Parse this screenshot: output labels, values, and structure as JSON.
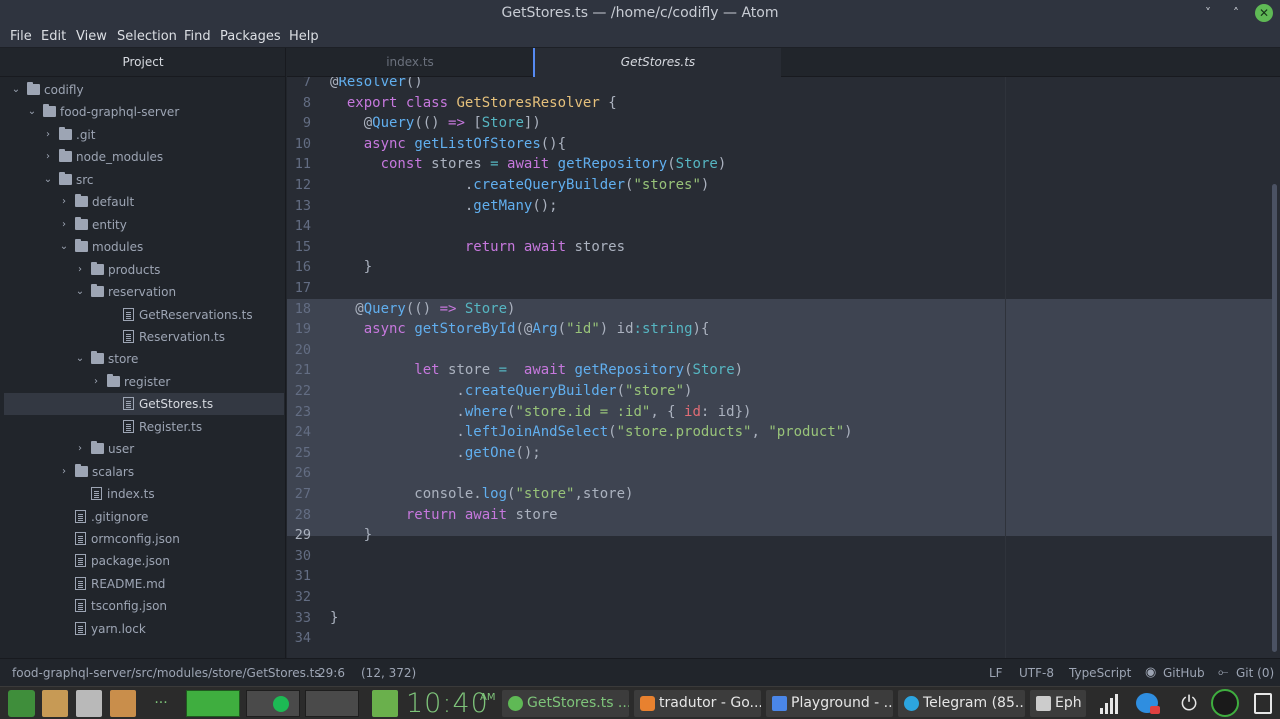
{
  "window": {
    "title": "GetStores.ts — /home/c/codifly — Atom",
    "controls": [
      "˅",
      "˄",
      "✕"
    ]
  },
  "menu": [
    "File",
    "Edit",
    "View",
    "Selection",
    "Find",
    "Packages",
    "Help"
  ],
  "tree": {
    "header": "Project",
    "items": [
      {
        "label": "codifly",
        "type": "folder",
        "depth": 0,
        "expanded": true
      },
      {
        "label": "food-graphql-server",
        "type": "folder",
        "depth": 1,
        "expanded": true
      },
      {
        "label": ".git",
        "type": "folder",
        "depth": 2,
        "expanded": false
      },
      {
        "label": "node_modules",
        "type": "folder",
        "depth": 2,
        "expanded": false
      },
      {
        "label": "src",
        "type": "folder",
        "depth": 2,
        "expanded": true
      },
      {
        "label": "default",
        "type": "folder",
        "depth": 3,
        "expanded": false
      },
      {
        "label": "entity",
        "type": "folder",
        "depth": 3,
        "expanded": false
      },
      {
        "label": "modules",
        "type": "folder",
        "depth": 3,
        "expanded": true
      },
      {
        "label": "products",
        "type": "folder",
        "depth": 4,
        "expanded": false
      },
      {
        "label": "reservation",
        "type": "folder",
        "depth": 4,
        "expanded": true
      },
      {
        "label": "GetReservations.ts",
        "type": "file",
        "depth": 5
      },
      {
        "label": "Reservation.ts",
        "type": "file",
        "depth": 5
      },
      {
        "label": "store",
        "type": "folder",
        "depth": 4,
        "expanded": true
      },
      {
        "label": "register",
        "type": "folder",
        "depth": 5,
        "expanded": false
      },
      {
        "label": "GetStores.ts",
        "type": "file",
        "depth": 5,
        "selected": true
      },
      {
        "label": "Register.ts",
        "type": "file",
        "depth": 5
      },
      {
        "label": "user",
        "type": "folder",
        "depth": 4,
        "expanded": false
      },
      {
        "label": "scalars",
        "type": "folder",
        "depth": 3,
        "expanded": false
      },
      {
        "label": "index.ts",
        "type": "file",
        "depth": 3
      },
      {
        "label": ".gitignore",
        "type": "file",
        "depth": 2
      },
      {
        "label": "ormconfig.json",
        "type": "file",
        "depth": 2
      },
      {
        "label": "package.json",
        "type": "file",
        "depth": 2
      },
      {
        "label": "README.md",
        "type": "file",
        "depth": 2
      },
      {
        "label": "tsconfig.json",
        "type": "file",
        "depth": 2
      },
      {
        "label": "yarn.lock",
        "type": "file",
        "depth": 2
      }
    ]
  },
  "tabs": [
    {
      "label": "index.ts",
      "active": false
    },
    {
      "label": "GetStores.ts",
      "active": true
    }
  ],
  "editor": {
    "first_line_number": 7,
    "cursor_line": 29,
    "selection_lines": [
      18,
      29
    ],
    "lines": [
      [
        [
          "@",
          "d"
        ],
        [
          "Resolver",
          "f"
        ],
        [
          "()",
          "d"
        ]
      ],
      [
        [
          "  ",
          "d"
        ],
        [
          "export",
          "k"
        ],
        [
          " ",
          "d"
        ],
        [
          "class",
          "k"
        ],
        [
          " ",
          "d"
        ],
        [
          "GetStoresResolver",
          "t"
        ],
        [
          " {",
          "d"
        ]
      ],
      [
        [
          "    @",
          "d"
        ],
        [
          "Query",
          "f"
        ],
        [
          "(() ",
          "d"
        ],
        [
          "=>",
          "k"
        ],
        [
          " [",
          "d"
        ],
        [
          "Store",
          "c"
        ],
        [
          "])",
          "d"
        ]
      ],
      [
        [
          "    ",
          "d"
        ],
        [
          "async",
          "k"
        ],
        [
          " ",
          "d"
        ],
        [
          "getListOfStores",
          "f"
        ],
        [
          "(){",
          "d"
        ]
      ],
      [
        [
          "      ",
          "d"
        ],
        [
          "const",
          "k"
        ],
        [
          " stores ",
          "d"
        ],
        [
          "=",
          "c"
        ],
        [
          " ",
          "d"
        ],
        [
          "await",
          "k"
        ],
        [
          " ",
          "d"
        ],
        [
          "getRepository",
          "f"
        ],
        [
          "(",
          "d"
        ],
        [
          "Store",
          "c"
        ],
        [
          ")",
          "d"
        ]
      ],
      [
        [
          "                .",
          "d"
        ],
        [
          "createQueryBuilder",
          "f"
        ],
        [
          "(",
          "d"
        ],
        [
          "\"stores\"",
          "s"
        ],
        [
          ")",
          "d"
        ]
      ],
      [
        [
          "                .",
          "d"
        ],
        [
          "getMany",
          "f"
        ],
        [
          "();",
          "d"
        ]
      ],
      [
        [
          "",
          "d"
        ]
      ],
      [
        [
          "                ",
          "d"
        ],
        [
          "return",
          "k"
        ],
        [
          " ",
          "d"
        ],
        [
          "await",
          "k"
        ],
        [
          " stores",
          "d"
        ]
      ],
      [
        [
          "    }",
          "d"
        ]
      ],
      [
        [
          "",
          "d"
        ]
      ],
      [
        [
          "   @",
          "d"
        ],
        [
          "Query",
          "f"
        ],
        [
          "(() ",
          "d"
        ],
        [
          "=>",
          "k"
        ],
        [
          " ",
          "d"
        ],
        [
          "Store",
          "c"
        ],
        [
          ")",
          "d"
        ]
      ],
      [
        [
          "    ",
          "d"
        ],
        [
          "async",
          "k"
        ],
        [
          " ",
          "d"
        ],
        [
          "getStoreById",
          "f"
        ],
        [
          "(@",
          "d"
        ],
        [
          "Arg",
          "f"
        ],
        [
          "(",
          "d"
        ],
        [
          "\"id\"",
          "s"
        ],
        [
          ") id",
          "d"
        ],
        [
          ":",
          "c"
        ],
        [
          "string",
          "c"
        ],
        [
          "){",
          "d"
        ]
      ],
      [
        [
          "",
          "d"
        ]
      ],
      [
        [
          "          ",
          "d"
        ],
        [
          "let",
          "k"
        ],
        [
          " store ",
          "d"
        ],
        [
          "=",
          "c"
        ],
        [
          "  ",
          "d"
        ],
        [
          "await",
          "k"
        ],
        [
          " ",
          "d"
        ],
        [
          "getRepository",
          "f"
        ],
        [
          "(",
          "d"
        ],
        [
          "Store",
          "c"
        ],
        [
          ")",
          "d"
        ]
      ],
      [
        [
          "               .",
          "d"
        ],
        [
          "createQueryBuilder",
          "f"
        ],
        [
          "(",
          "d"
        ],
        [
          "\"store\"",
          "s"
        ],
        [
          ")",
          "d"
        ]
      ],
      [
        [
          "               .",
          "d"
        ],
        [
          "where",
          "f"
        ],
        [
          "(",
          "d"
        ],
        [
          "\"store.id = :id\"",
          "s"
        ],
        [
          ", { ",
          "d"
        ],
        [
          "id",
          "r"
        ],
        [
          ": id})",
          "d"
        ]
      ],
      [
        [
          "               .",
          "d"
        ],
        [
          "leftJoinAndSelect",
          "f"
        ],
        [
          "(",
          "d"
        ],
        [
          "\"store.products\"",
          "s"
        ],
        [
          ", ",
          "d"
        ],
        [
          "\"product\"",
          "s"
        ],
        [
          ")",
          "d"
        ]
      ],
      [
        [
          "               .",
          "d"
        ],
        [
          "getOne",
          "f"
        ],
        [
          "();",
          "d"
        ]
      ],
      [
        [
          "",
          "d"
        ]
      ],
      [
        [
          "          console.",
          "d"
        ],
        [
          "log",
          "f"
        ],
        [
          "(",
          "d"
        ],
        [
          "\"store\"",
          "s"
        ],
        [
          ",store)",
          "d"
        ]
      ],
      [
        [
          "         ",
          "d"
        ],
        [
          "return",
          "k"
        ],
        [
          " ",
          "d"
        ],
        [
          "await",
          "k"
        ],
        [
          " store",
          "d"
        ]
      ],
      [
        [
          "    }",
          "d"
        ]
      ],
      [
        [
          "",
          "d"
        ]
      ],
      [
        [
          "",
          "d"
        ]
      ],
      [
        [
          "",
          "d"
        ]
      ],
      [
        [
          "}",
          "d"
        ]
      ],
      [
        [
          "",
          "d"
        ]
      ]
    ]
  },
  "status": {
    "path": "food-graphql-server/src/modules/store/GetStores.ts",
    "cursor": "29:6",
    "selection": "(12, 372)",
    "line_ending": "LF",
    "encoding": "UTF-8",
    "grammar": "TypeScript",
    "github": "GitHub",
    "git": "Git (0)"
  },
  "taskbar": {
    "dots": "···",
    "clock": "10:40",
    "ampm": "AM",
    "windows": [
      {
        "label": "GetStores.ts ...",
        "color": "#5fb955"
      },
      {
        "label": "tradutor - Go...",
        "color": "#e8812f"
      },
      {
        "label": "Playground - ...",
        "color": "#4a86e8"
      },
      {
        "label": "Telegram (85...",
        "color": "#2ca5e0"
      },
      {
        "label": "Eph",
        "color": "#cccccc"
      }
    ]
  }
}
